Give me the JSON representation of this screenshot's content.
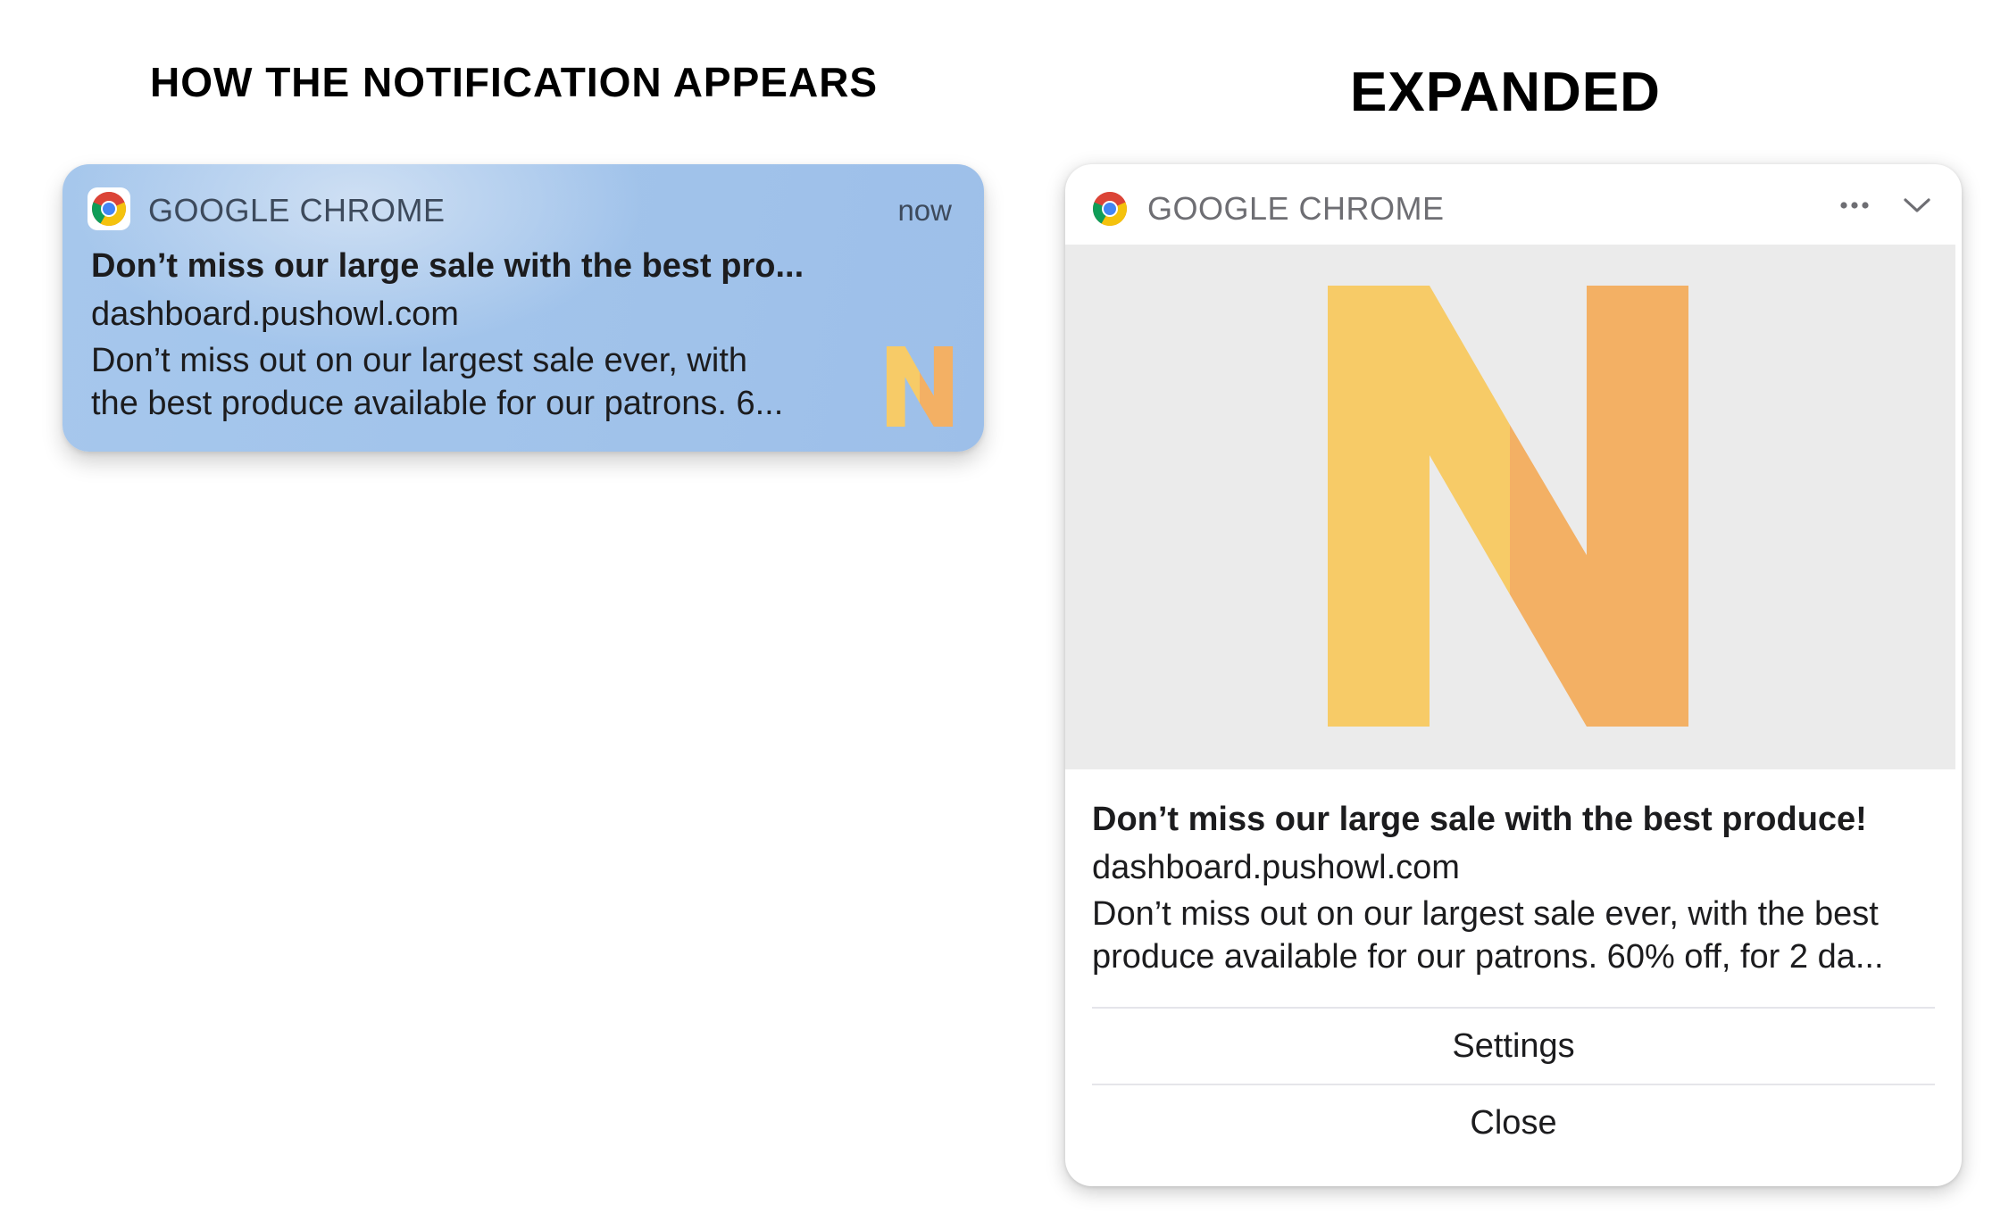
{
  "headings": {
    "collapsed": "HOW THE NOTIFICATION APPEARS",
    "expanded": "EXPANDED"
  },
  "banner": {
    "app_name": "GOOGLE CHROME",
    "app_icon": "chrome-logo-icon",
    "time": "now",
    "title": "Don’t miss our large sale with the best pro...",
    "domain": "dashboard.pushowl.com",
    "body_line_1": "Don’t miss out on our largest sale ever, with",
    "body_line_2": "the best produce available for our patrons. 6...",
    "thumbnail_icon": "n-logo-thumbnail"
  },
  "expanded": {
    "app_name": "GOOGLE CHROME",
    "app_icon": "chrome-logo-icon",
    "more_icon": "ellipsis-icon",
    "collapse_icon": "chevron-down-icon",
    "hero_image": "n-logo-image",
    "title": "Don’t miss our large sale with the best produce!",
    "domain": "dashboard.pushowl.com",
    "body_line_1": "Don’t miss out on our largest sale ever, with the best",
    "body_line_2": "produce available for our patrons. 60% off, for 2 da...",
    "actions": {
      "settings": "Settings",
      "close": "Close"
    }
  },
  "colors": {
    "banner_blue": "#a2c4eb",
    "n_yellow": "#f7cb67",
    "n_orange": "#f3b064",
    "hero_bg": "#ebebeb"
  }
}
